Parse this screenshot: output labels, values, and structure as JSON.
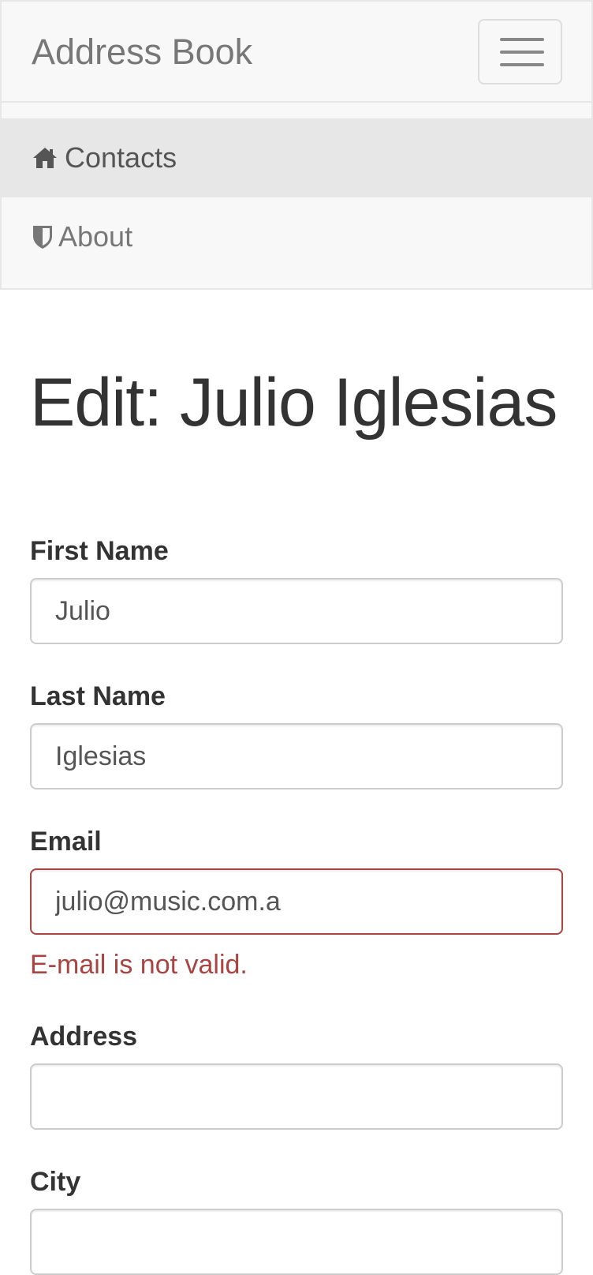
{
  "navbar": {
    "brand": "Address Book",
    "toggle_icon": "hamburger-menu-icon",
    "items": [
      {
        "label": "Contacts",
        "icon": "home-icon",
        "active": true
      },
      {
        "label": "About",
        "icon": "shield-icon",
        "active": false
      }
    ]
  },
  "page": {
    "title": "Edit: Julio Iglesias"
  },
  "form": {
    "first_name": {
      "label": "First Name",
      "value": "Julio"
    },
    "last_name": {
      "label": "Last Name",
      "value": "Iglesias"
    },
    "email": {
      "label": "Email",
      "value": "julio@music.com.a",
      "error": "E-mail is not valid."
    },
    "address": {
      "label": "Address",
      "value": ""
    },
    "city": {
      "label": "City",
      "value": ""
    }
  },
  "colors": {
    "navbar_bg": "#f8f8f8",
    "active_item_bg": "#e7e7e7",
    "error": "#a94442",
    "text": "#333333"
  }
}
